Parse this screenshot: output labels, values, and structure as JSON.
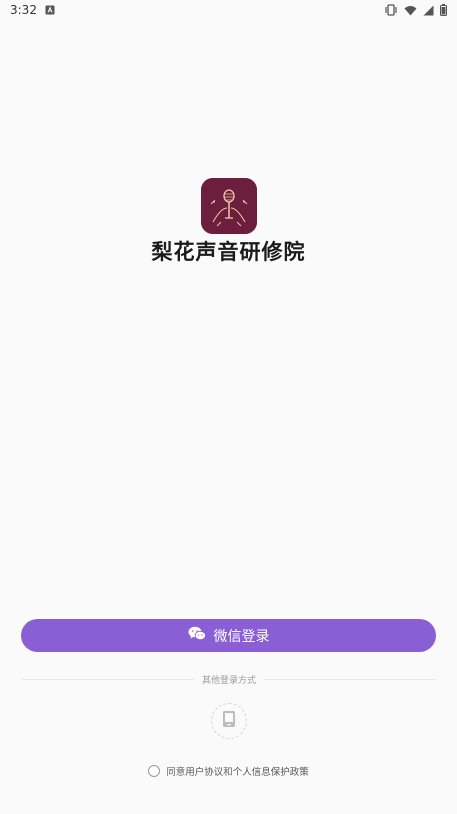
{
  "status_bar": {
    "time": "3:32",
    "icons": [
      "notification-a-icon",
      "vibrate-icon",
      "wifi-icon",
      "signal-icon",
      "battery-icon"
    ]
  },
  "app": {
    "name": "梨花声音研修院",
    "logo_icon": "microphone-logo-icon",
    "logo_color": "#6c1f3d"
  },
  "login": {
    "wechat_label": "微信登录",
    "wechat_icon": "wechat-icon",
    "accent_color": "#8a5fd6",
    "other_methods_label": "其他登录方式",
    "phone_icon": "phone-icon"
  },
  "agreement": {
    "prefix": "同意",
    "user_agreement": "用户协议",
    "conjunction": "和",
    "privacy_policy": "个人信息保护政策"
  }
}
